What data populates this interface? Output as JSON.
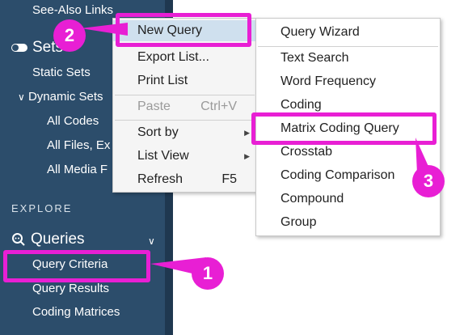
{
  "sidebar": {
    "top_item": "See-Also Links",
    "sets_header": "Sets",
    "sets_items": [
      "Static Sets",
      "Dynamic Sets"
    ],
    "dynamic_sets_children": [
      "All Codes",
      "All Files, Ex",
      "All Media F"
    ],
    "explore_section": "EXPLORE",
    "queries_header": "Queries",
    "queries_items": [
      "Query Criteria",
      "Query Results",
      "Coding Matrices"
    ]
  },
  "context_menu": {
    "items": [
      {
        "label": "New Query",
        "shortcut": "",
        "submenu": false,
        "disabled": false
      },
      {
        "label": "Export List...",
        "shortcut": "",
        "submenu": false,
        "disabled": false
      },
      {
        "label": "Print List",
        "shortcut": "",
        "submenu": false,
        "disabled": false
      },
      {
        "label": "Paste",
        "shortcut": "Ctrl+V",
        "submenu": false,
        "disabled": true
      },
      {
        "label": "Sort by",
        "shortcut": "",
        "submenu": true,
        "disabled": false
      },
      {
        "label": "List View",
        "shortcut": "",
        "submenu": true,
        "disabled": false
      },
      {
        "label": "Refresh",
        "shortcut": "F5",
        "submenu": false,
        "disabled": false
      }
    ]
  },
  "submenu": {
    "items": [
      "Query Wizard",
      "Text Search",
      "Word Frequency",
      "Coding",
      "Matrix Coding Query",
      "Crosstab",
      "Coding Comparison",
      "Compound",
      "Group"
    ]
  },
  "annotations": {
    "step1": "1",
    "step2": "2",
    "step3": "3",
    "color": "#e81fd4"
  },
  "colors": {
    "sidebar_bg": "#2c4d6b",
    "menu_highlight": "#cfe0ee"
  }
}
